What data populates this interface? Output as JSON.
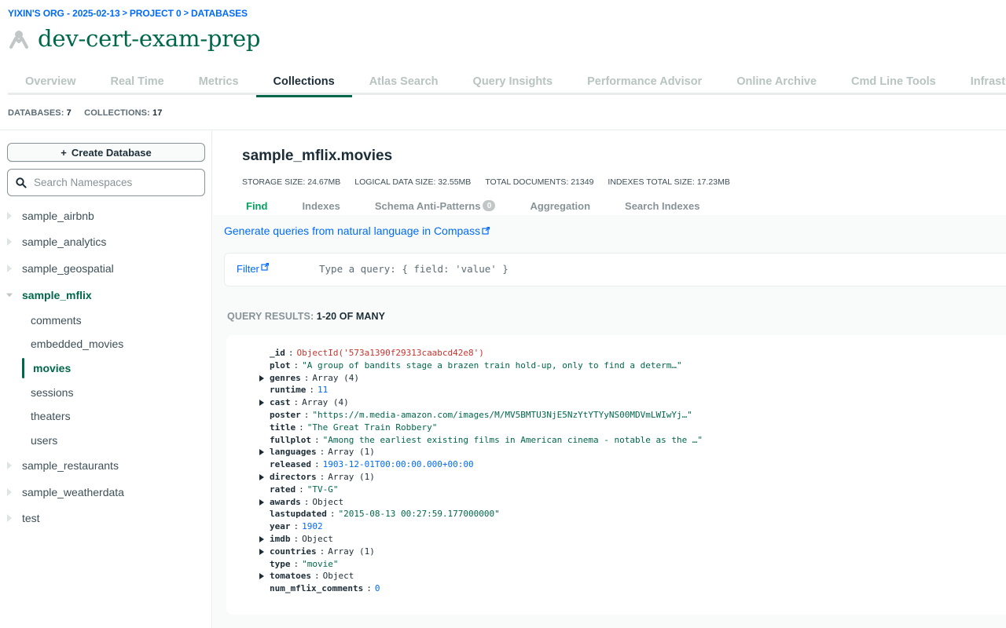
{
  "breadcrumb": {
    "org": "YIXIN'S ORG - 2025-02-13",
    "project": "PROJECT 0",
    "section": "DATABASES"
  },
  "cluster_name": "dev-cert-exam-prep",
  "tabs": [
    "Overview",
    "Real Time",
    "Metrics",
    "Collections",
    "Atlas Search",
    "Query Insights",
    "Performance Advisor",
    "Online Archive",
    "Cmd Line Tools",
    "Infrastruct"
  ],
  "active_tab": "Collections",
  "counts": {
    "databases_label": "DATABASES:",
    "databases_value": "7",
    "collections_label": "COLLECTIONS:",
    "collections_value": "17"
  },
  "sidebar": {
    "create_label": "Create Database",
    "search_placeholder": "Search Namespaces",
    "databases": [
      "sample_airbnb",
      "sample_analytics",
      "sample_geospatial",
      "sample_mflix",
      "sample_restaurants",
      "sample_weatherdata",
      "test"
    ],
    "open_database": "sample_mflix",
    "collections": [
      "comments",
      "embedded_movies",
      "movies",
      "sessions",
      "theaters",
      "users"
    ],
    "active_collection": "movies"
  },
  "collection": {
    "title": "sample_mflix.movies",
    "stats": {
      "storage": "STORAGE SIZE: 24.67MB",
      "logical": "LOGICAL DATA SIZE: 32.55MB",
      "documents": "TOTAL DOCUMENTS: 21349",
      "indexes": "INDEXES TOTAL SIZE: 17.23MB"
    },
    "subtabs": [
      "Find",
      "Indexes",
      "Schema Anti-Patterns",
      "Aggregation",
      "Search Indexes"
    ],
    "antipattern_count": "0",
    "active_subtab": "Find"
  },
  "nl_query_link": "Generate queries from natural language in Compass",
  "filter": {
    "label": "Filter",
    "placeholder": "Type a query: { field: 'value' }"
  },
  "results": {
    "label": "QUERY RESULTS:",
    "range": "1-20 OF MANY"
  },
  "document": [
    {
      "key": "_id",
      "value": "ObjectId('573a1390f29313caabcd42e8')",
      "kind": "oid",
      "expandable": false
    },
    {
      "key": "plot",
      "value": "\"A group of bandits stage a brazen train hold-up, only to find a determ…\"",
      "kind": "str",
      "expandable": false
    },
    {
      "key": "genres",
      "value": "Array (4)",
      "kind": "type",
      "expandable": true
    },
    {
      "key": "runtime",
      "value": "11",
      "kind": "num",
      "expandable": false
    },
    {
      "key": "cast",
      "value": "Array (4)",
      "kind": "type",
      "expandable": true
    },
    {
      "key": "poster",
      "value": "\"https://m.media-amazon.com/images/M/MV5BMTU3NjE5NzYtYTYyNS00MDVmLWIwYj…\"",
      "kind": "str",
      "expandable": false
    },
    {
      "key": "title",
      "value": "\"The Great Train Robbery\"",
      "kind": "str",
      "expandable": false
    },
    {
      "key": "fullplot",
      "value": "\"Among the earliest existing films in American cinema - notable as the …\"",
      "kind": "str",
      "expandable": false
    },
    {
      "key": "languages",
      "value": "Array (1)",
      "kind": "type",
      "expandable": true
    },
    {
      "key": "released",
      "value": "1903-12-01T00:00:00.000+00:00",
      "kind": "date",
      "expandable": false
    },
    {
      "key": "directors",
      "value": "Array (1)",
      "kind": "type",
      "expandable": true
    },
    {
      "key": "rated",
      "value": "\"TV-G\"",
      "kind": "str",
      "expandable": false
    },
    {
      "key": "awards",
      "value": "Object",
      "kind": "type",
      "expandable": true
    },
    {
      "key": "lastupdated",
      "value": "\"2015-08-13 00:27:59.177000000\"",
      "kind": "str",
      "expandable": false
    },
    {
      "key": "year",
      "value": "1902",
      "kind": "num",
      "expandable": false
    },
    {
      "key": "imdb",
      "value": "Object",
      "kind": "type",
      "expandable": true
    },
    {
      "key": "countries",
      "value": "Array (1)",
      "kind": "type",
      "expandable": true
    },
    {
      "key": "type",
      "value": "\"movie\"",
      "kind": "str",
      "expandable": false
    },
    {
      "key": "tomatoes",
      "value": "Object",
      "kind": "type",
      "expandable": true
    },
    {
      "key": "num_mflix_comments",
      "value": "0",
      "kind": "num",
      "expandable": false
    }
  ],
  "colors": {
    "brand_green": "#00684a",
    "link_blue": "#016bf8",
    "objectid_red": "#c9332e",
    "find_green": "#00a35c"
  }
}
